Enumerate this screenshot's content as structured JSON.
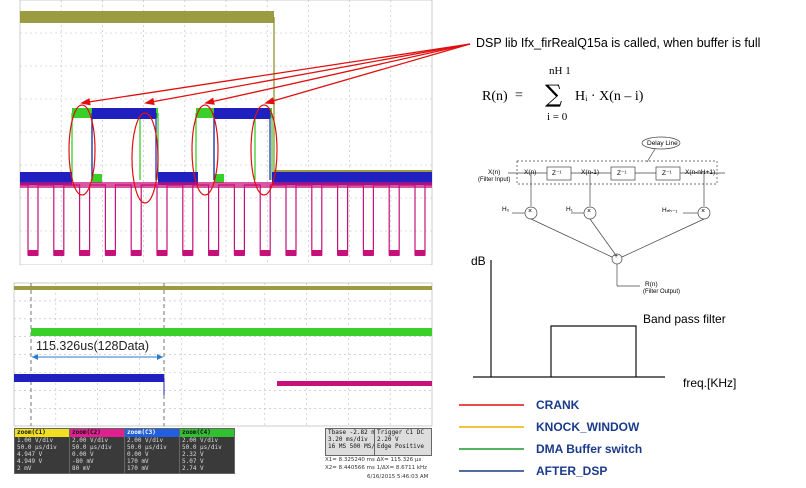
{
  "annotation": {
    "dsp_call": "DSP lib Ifx_firRealQ15a is called, when buffer is full"
  },
  "formula": {
    "lhs": "R(n)",
    "equals": "=",
    "sum_upper": "nH 1",
    "sum_lower": "i = 0",
    "rhs": "Hᵢ · X(n – i)"
  },
  "fir_diagram": {
    "delay_line": "Delay Line",
    "input_label": "X(n)",
    "input_sub": "(Filter Input)",
    "taps": [
      "X(n)",
      "X(n-1)",
      "X(n-nH+1)"
    ],
    "delays": [
      "Z⁻¹",
      "Z⁻¹",
      "Z⁻¹"
    ],
    "coefs": [
      "H₀",
      "H₁",
      "Hₙₕ₋₁"
    ],
    "sum_symbol": "+",
    "mult_symbol": "×",
    "output_label": "R(n)",
    "output_sub": "(Filter Output)"
  },
  "filter_plot": {
    "ylabel": "dB",
    "xlabel": "freq.[KHz]",
    "band_label": "Band pass filter"
  },
  "legend": [
    {
      "label": "CRANK",
      "color": "#e01010"
    },
    {
      "label": "KNOCK_WINDOW",
      "color": "#f0b000"
    },
    {
      "label": "DMA Buffer switch",
      "color": "#1a9a2a"
    },
    {
      "label": "AFTER_DSP",
      "color": "#1a3a8a"
    }
  ],
  "scope": {
    "measurement": "115.326us(128Data)",
    "channels": [
      {
        "name": "zoom(C1)",
        "color": "#f0e020",
        "rows": [
          "1.00 V/div",
          "50.0 µs/div",
          "4.947 V",
          "4.949 V",
          "2 mV"
        ]
      },
      {
        "name": "zoom(C2)",
        "color": "#e02090",
        "rows": [
          "2.00 V/div",
          "50.0 µs/div",
          "0.00 V",
          "-80 mV",
          "80 mV"
        ]
      },
      {
        "name": "zoom(C3)",
        "color": "#2060e0",
        "rows": [
          "2.00 V/div",
          "50.0 µs/div",
          "0.00 V",
          "170 mV",
          "170 mV"
        ]
      },
      {
        "name": "zoom(C4)",
        "color": "#30c030",
        "rows": [
          "2.00 V/div",
          "50.0 µs/div",
          "2.32 V",
          "5.07 V",
          "2.74 V"
        ]
      }
    ],
    "timebase": [
      "Tbase  -2.82 ms",
      "3.20 ms/div",
      "16 MS   500 MS/s"
    ],
    "trigger": [
      "Trigger C1 DC",
      "2.20 V",
      "Edge  Positive"
    ],
    "cursors": [
      "X1= 8.325240 ms   ΔX= 115.326 µs",
      "X2= 8.440566 ms   1/ΔX= 8.6711 kHz"
    ],
    "timestamp": "6/16/2015 5:46:03 AM"
  },
  "colors": {
    "crank": "#e01010",
    "green_trace": "#3ad02a",
    "blue_trace": "#2020c0",
    "magenta_trace": "#c8107a",
    "olive_trace": "#8a8a20"
  }
}
